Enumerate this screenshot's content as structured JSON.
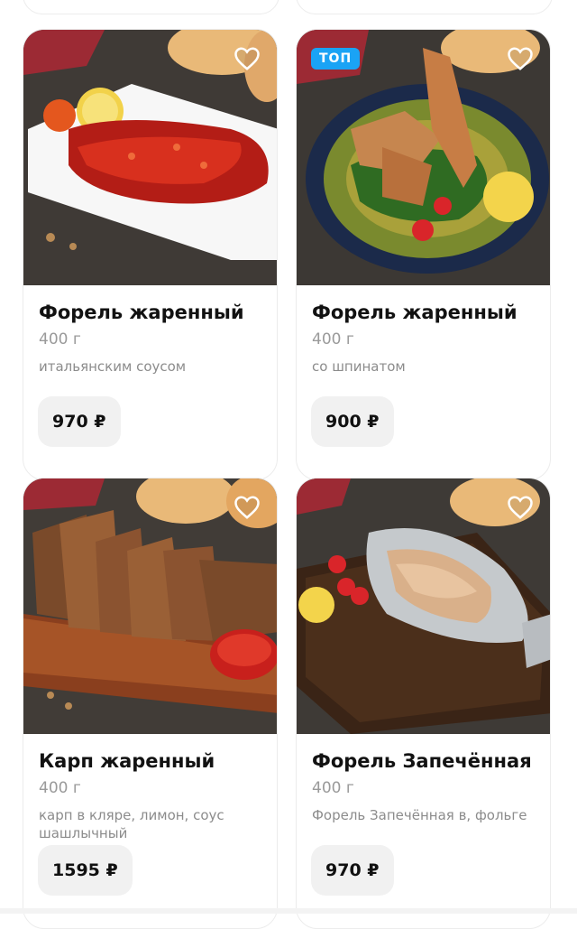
{
  "products": [
    {
      "name": "Форель жаренный",
      "weight": "400 г",
      "description": "итальянским соусом",
      "price": "970 ₽",
      "badge": "",
      "image_icon": "fried-trout-photo"
    },
    {
      "name": "Форель жаренный",
      "weight": "400 г",
      "description": "со шпинатом",
      "price": "900 ₽",
      "badge": "ТОП",
      "image_icon": "fried-trout-spinach-photo"
    },
    {
      "name": "Карп жаренный",
      "weight": "400 г",
      "description": "карп в кляре, лимон, соус шашлычный",
      "price": "1595 ₽",
      "badge": "",
      "image_icon": "fried-carp-photo"
    },
    {
      "name": "Форель Запечённая",
      "weight": "400 г",
      "description": "Форель Запечённая в, фольге",
      "price": "970 ₽",
      "badge": "",
      "image_icon": "baked-trout-foil-photo"
    }
  ],
  "colors": {
    "badge": "#1aa3f5",
    "price_button_bg": "#f1f1f1",
    "card_border": "#ececec"
  }
}
